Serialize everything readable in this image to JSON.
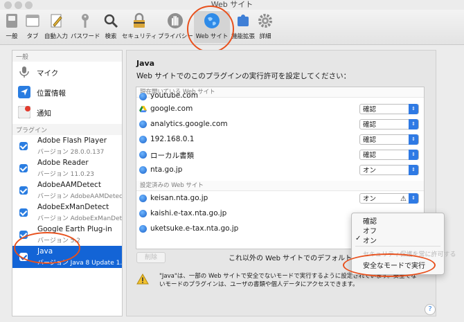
{
  "window": {
    "title": "Web サイト"
  },
  "toolbar": {
    "items": [
      {
        "label": "一般",
        "icon": "switch-icon"
      },
      {
        "label": "タブ",
        "icon": "tabs-icon"
      },
      {
        "label": "自動入力",
        "icon": "pencil-icon"
      },
      {
        "label": "パスワード",
        "icon": "key-icon"
      },
      {
        "label": "検索",
        "icon": "search-icon"
      },
      {
        "label": "セキュリティ",
        "icon": "lock-icon"
      },
      {
        "label": "プライバシー",
        "icon": "hand-icon"
      },
      {
        "label": "Web サイト",
        "icon": "globe-icon"
      },
      {
        "label": "機能拡張",
        "icon": "puzzle-icon"
      },
      {
        "label": "詳細",
        "icon": "gear-icon"
      }
    ],
    "selected": "Web サイト"
  },
  "sidebar": {
    "general_header": "一般",
    "general_items": [
      {
        "label": "マイク",
        "icon": "microphone-icon"
      },
      {
        "label": "位置情報",
        "icon": "location-icon"
      },
      {
        "label": "通知",
        "icon": "notification-icon"
      }
    ],
    "plugins_header": "プラグイン",
    "plugins": [
      {
        "name": "Adobe Flash Player",
        "version": "バージョン 28.0.0.137"
      },
      {
        "name": "Adobe Reader",
        "version": "バージョン 11.0.23"
      },
      {
        "name": "AdobeAAMDetect",
        "version": "バージョン AdobeAAMDetect..."
      },
      {
        "name": "AdobeExManDetect",
        "version": "バージョン AdobeExManDet..."
      },
      {
        "name": "Google Earth Plug-in",
        "version": "バージョン 5.2"
      },
      {
        "name": "Java",
        "version": "バージョン Java 8 Update 1..."
      }
    ]
  },
  "main": {
    "plugin_title": "Java",
    "instruction": "Web サイトでのこのプラグインの実行許可を設定してください：",
    "open_header": "現在開いている Web サイト",
    "open_sites": [
      {
        "site": "youtube.com",
        "value": "確認",
        "icon": "globe-icon"
      },
      {
        "site": "google.com",
        "value": "確認",
        "icon": "google-drive-icon"
      },
      {
        "site": "analytics.google.com",
        "value": "確認",
        "icon": "globe-icon"
      },
      {
        "site": "192.168.0.1",
        "value": "確認",
        "icon": "globe-icon"
      },
      {
        "site": "ローカル書類",
        "value": "確認",
        "icon": "globe-icon"
      },
      {
        "site": "nta.go.jp",
        "value": "オン",
        "icon": "globe-icon"
      }
    ],
    "configured_header": "設定済みの Web サイト",
    "configured_sites": [
      {
        "site": "keisan.nta.go.jp",
        "value": "オン"
      },
      {
        "site": "kaishi.e-tax.nta.go.jp",
        "value": ""
      },
      {
        "site": "uketsuke.e-tax.nta.go.jp",
        "value": ""
      }
    ],
    "remove_button": "削除",
    "default_label": "これ以外の Web サイトでのデフォルト設定：",
    "warning": "\"Java\"は、一部の Web サイトで安全でないモードで実行するように設定されています。安全でないモードのプラグインは、ユーザの書類や個人データにアクセスできます。"
  },
  "popup": {
    "items": [
      "確認",
      "オフ",
      "オン"
    ],
    "checked": "オン",
    "disabled_item": "セキュリティ保護を常に許可する",
    "last_item": "安全なモードで実行"
  },
  "help": "?"
}
